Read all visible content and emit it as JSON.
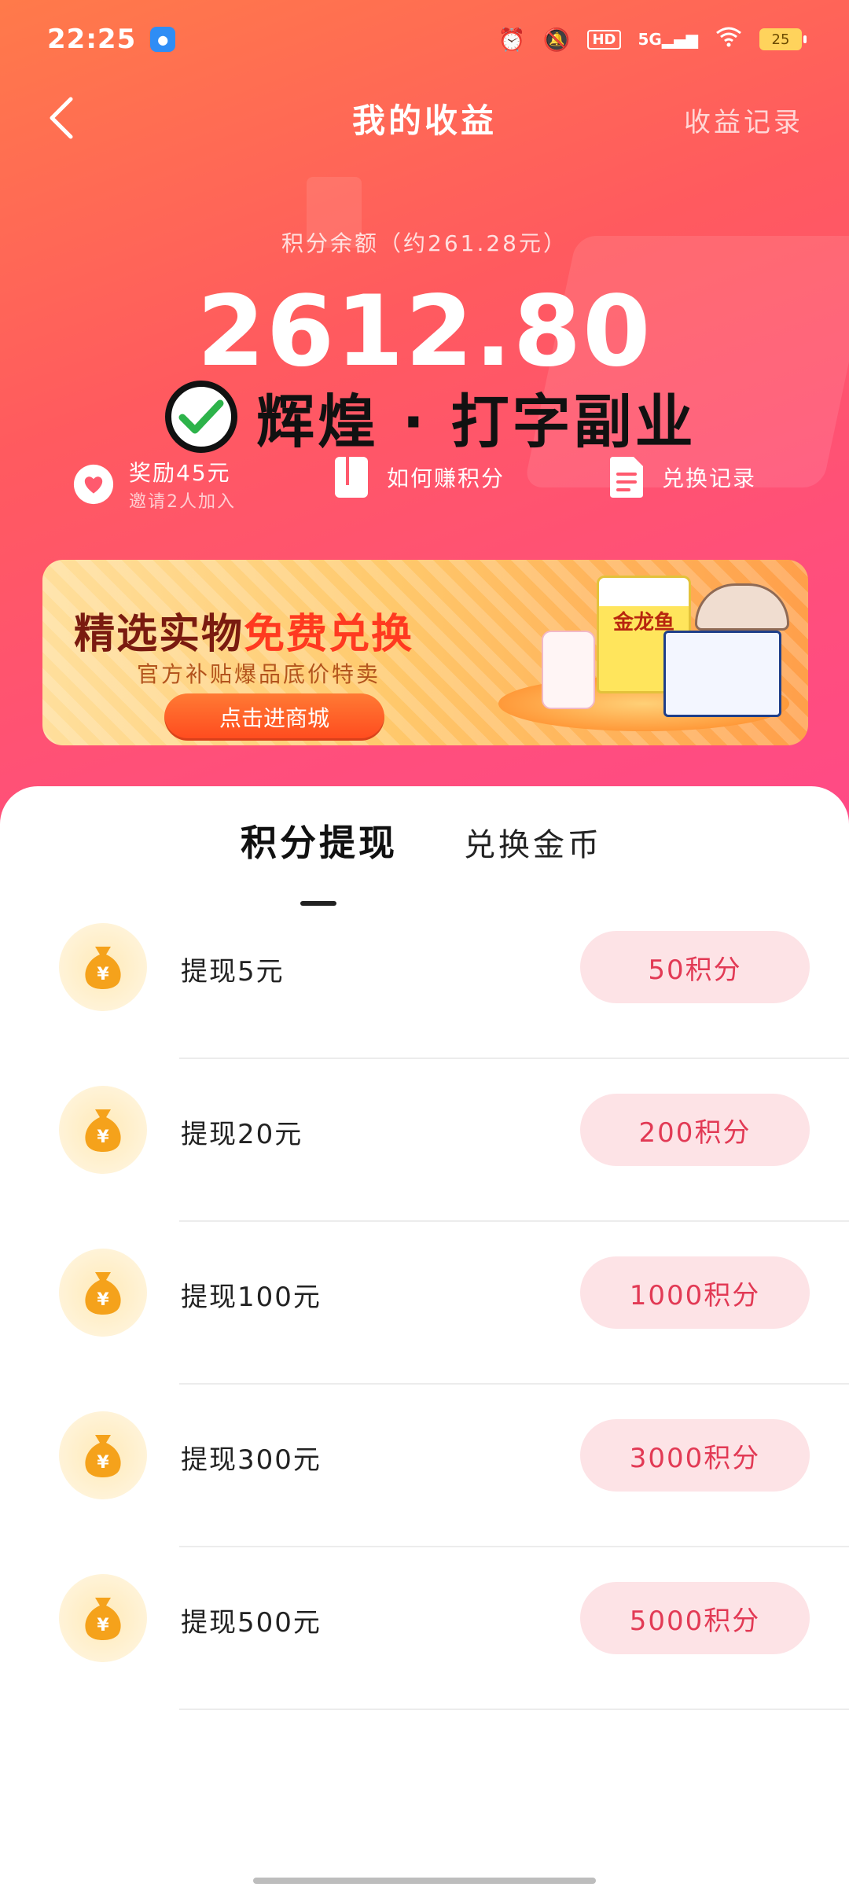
{
  "status_bar": {
    "time": "22:25",
    "network": "5G",
    "hd": "HD",
    "battery": "25"
  },
  "nav": {
    "back_icon": "chevron-left-icon",
    "title": "我的收益",
    "right_link": "收益记录"
  },
  "balance": {
    "label": "积分余额（约261.28元）",
    "value": "2612.80"
  },
  "watermark": {
    "text": "辉煌 · 打字副业"
  },
  "shortcuts": [
    {
      "label": "奖励45元",
      "sub": "邀请2人加入",
      "icon": "heart-icon"
    },
    {
      "label": "如何赚积分",
      "icon": "book-icon"
    },
    {
      "label": "兑换记录",
      "icon": "document-icon"
    }
  ],
  "banner": {
    "title_part1": "精选实物",
    "title_part2": "免费兑换",
    "subtitle": "官方补贴爆品底价特卖",
    "button": "点击进商城",
    "product_label": "金龙鱼"
  },
  "tabs": [
    {
      "label": "积分提现",
      "active": true
    },
    {
      "label": "兑换金币",
      "active": false
    }
  ],
  "withdraw_items": [
    {
      "label": "提现5元",
      "points": "50积分"
    },
    {
      "label": "提现20元",
      "points": "200积分"
    },
    {
      "label": "提现100元",
      "points": "1000积分"
    },
    {
      "label": "提现300元",
      "points": "3000积分"
    },
    {
      "label": "提现500元",
      "points": "5000积分"
    }
  ],
  "colors": {
    "accent": "#e23a55",
    "button_bg": "#fde3e6",
    "hero_start": "#ff7a4a",
    "hero_end": "#ff4a86"
  }
}
